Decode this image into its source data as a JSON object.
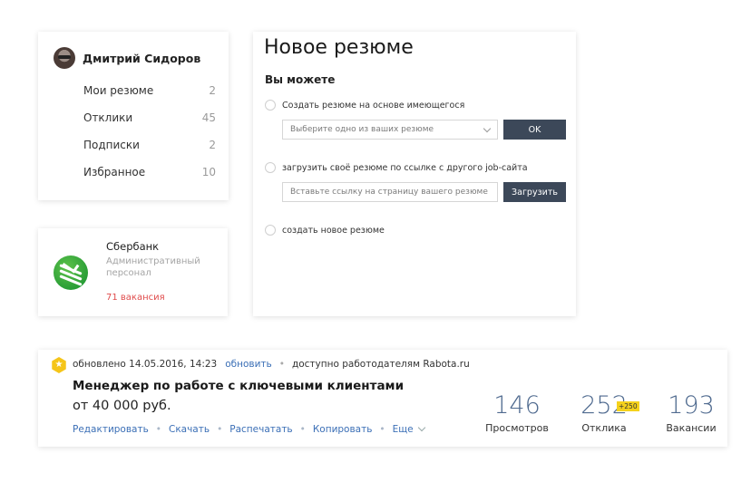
{
  "profile": {
    "name": "Дмитрий Сидоров",
    "menu": [
      {
        "label": "Мои резюме",
        "count": "2"
      },
      {
        "label": "Отклики",
        "count": "45"
      },
      {
        "label": "Подписки",
        "count": "2"
      },
      {
        "label": "Избранное",
        "count": "10"
      }
    ]
  },
  "company": {
    "name": "Сбербанк",
    "category": "Административный персонал",
    "vacancies": "71 вакансия",
    "brand_color": "#21a038"
  },
  "new_resume": {
    "title": "Новое резюме",
    "subtitle": "Вы можете",
    "option1": "Создать резюме на основе имеющегося",
    "select_placeholder": "Выберите одно из ваших резюме",
    "ok_label": "OK",
    "option2": "загрузить своё резюме по ссылке с другого job-сайта",
    "link_placeholder": "Вставьте ссылку на страницу вашего резюме",
    "upload_label": "Загрузить",
    "option3": "создать новое резюме",
    "button_color": "#3c4859"
  },
  "resume": {
    "badge_icon": "star-icon",
    "updated": "обновлено 14.05.2016, 14:23",
    "refresh": "обновить",
    "visibility": "доступно работодателям Rabota.ru",
    "title": "Менеджер по работе с ключевыми клиентами",
    "salary": "от 40 000 руб.",
    "actions": {
      "edit": "Редактировать",
      "download": "Скачать",
      "print": "Распечатать",
      "copy": "Копировать",
      "more": "Еще"
    },
    "stats": {
      "views": {
        "value": "146",
        "label": "Просмотров"
      },
      "responses": {
        "value": "252",
        "label": "Отклика",
        "new": "+250"
      },
      "vacancies": {
        "value": "193",
        "label": "Вакансии"
      }
    },
    "link_color": "#3b6fb6",
    "accent_color": "#f5c519"
  }
}
